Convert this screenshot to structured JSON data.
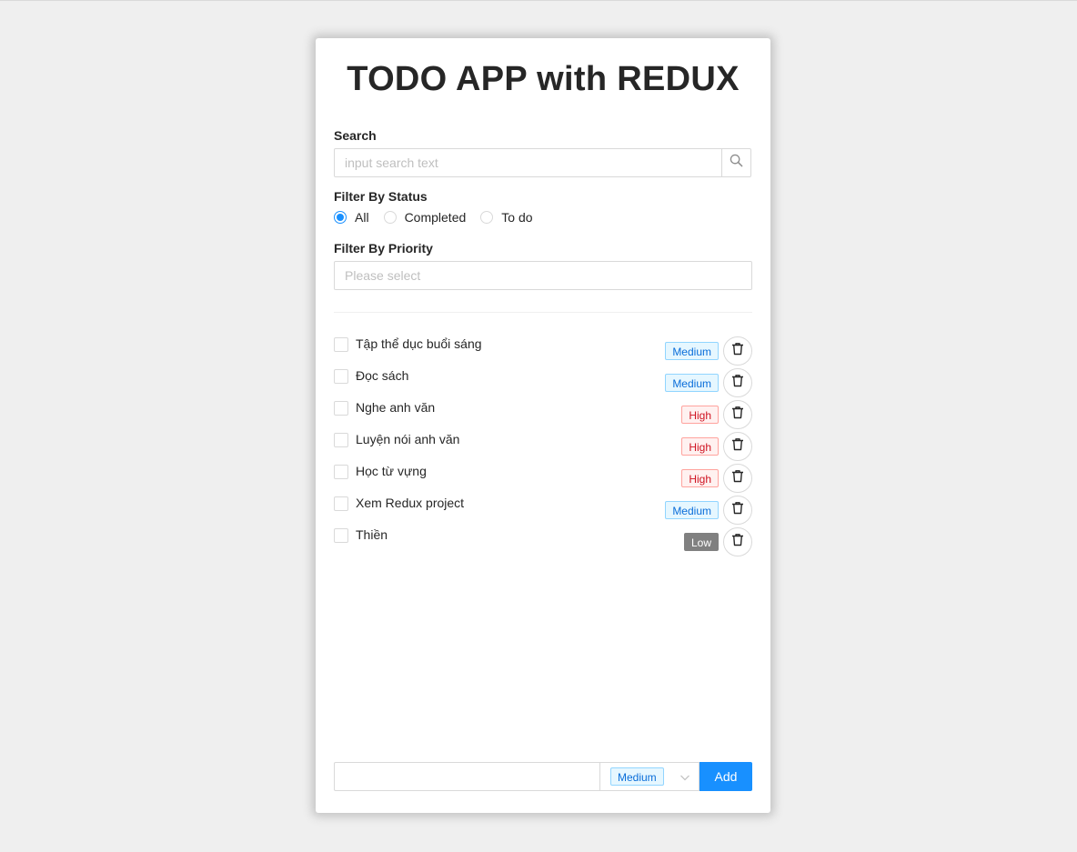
{
  "app": {
    "title": "TODO APP with REDUX"
  },
  "search": {
    "label": "Search",
    "placeholder": "input search text",
    "icon": "search-icon"
  },
  "status_filter": {
    "label": "Filter By Status",
    "options": [
      {
        "label": "All",
        "checked": true
      },
      {
        "label": "Completed",
        "checked": false
      },
      {
        "label": "To do",
        "checked": false
      }
    ]
  },
  "priority_filter": {
    "label": "Filter By Priority",
    "placeholder": "Please select"
  },
  "todos": [
    {
      "name": "Tập thể dục buổi sáng",
      "priority": "Medium",
      "completed": false
    },
    {
      "name": "Đọc sách",
      "priority": "Medium",
      "completed": false
    },
    {
      "name": "Nghe anh văn",
      "priority": "High",
      "completed": false
    },
    {
      "name": "Luyện nói anh văn",
      "priority": "High",
      "completed": false
    },
    {
      "name": "Học từ vựng",
      "priority": "High",
      "completed": false
    },
    {
      "name": "Xem Redux project",
      "priority": "Medium",
      "completed": false
    },
    {
      "name": "Thiền",
      "priority": "Low",
      "completed": false
    }
  ],
  "add_form": {
    "input_value": "",
    "selected_priority": "Medium",
    "add_label": "Add"
  },
  "colors": {
    "accent": "#1890ff",
    "medium_tag": "#096dd9",
    "high_tag": "#cf1322",
    "low_tag": "#808080"
  }
}
